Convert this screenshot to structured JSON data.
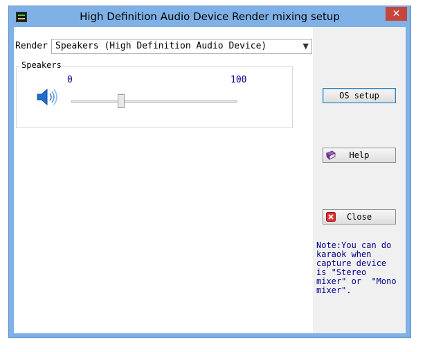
{
  "window": {
    "title": "High Definition Audio Device Render mixing setup",
    "close_symbol": "✕",
    "app_icon": "audio-mixer-icon"
  },
  "render": {
    "label": "Render",
    "selected": "Speakers (High Definition Audio Device)"
  },
  "speakers_group": {
    "label": "Speakers",
    "min_label": "0",
    "max_label": "100",
    "volume": 30,
    "icon": "speaker-icon"
  },
  "buttons": {
    "os_setup": "OS setup",
    "help": "Help",
    "close": "Close"
  },
  "note": "Note:You can do\nkaraok when\ncapture device\nis \"Stereo\nmixer\" or  \"Mono\nmixer\".",
  "colors": {
    "frame": "#7fb1e6",
    "note_text": "#00008b",
    "close_button": "#c7463b"
  }
}
